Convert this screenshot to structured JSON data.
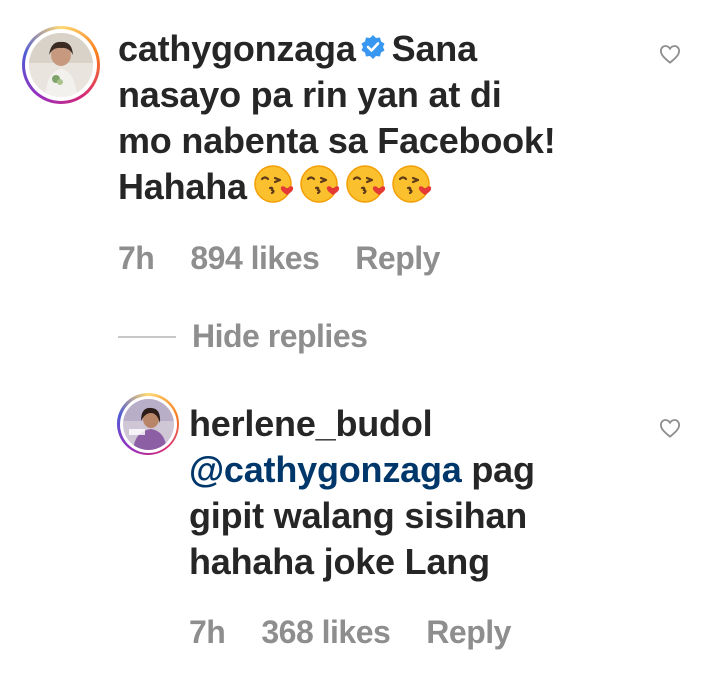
{
  "comments": [
    {
      "username": "cathygonzaga",
      "verified": true,
      "lines": [
        "Sana",
        "nasayo pa rin yan at di",
        "mo nabenta sa Facebook!",
        "Hahaha"
      ],
      "emoji": "kissing-face-with-heart",
      "emoji_count": 4,
      "time": "7h",
      "likes": "894 likes",
      "reply_label": "Reply"
    },
    {
      "username": "herlene_budol",
      "mention": "@cathygonzaga",
      "lines": [
        " pag",
        "gipit walang sisihan",
        "hahaha joke Lang"
      ],
      "time": "7h",
      "likes": "368 likes",
      "reply_label": "Reply"
    }
  ],
  "hide_replies_label": "Hide replies",
  "icons": {
    "like": "heart-outline-icon",
    "verified": "verified-badge-icon"
  },
  "colors": {
    "text": "#262626",
    "meta": "#8e8e8e",
    "mention": "#00376b",
    "verified": "#3897f0"
  }
}
